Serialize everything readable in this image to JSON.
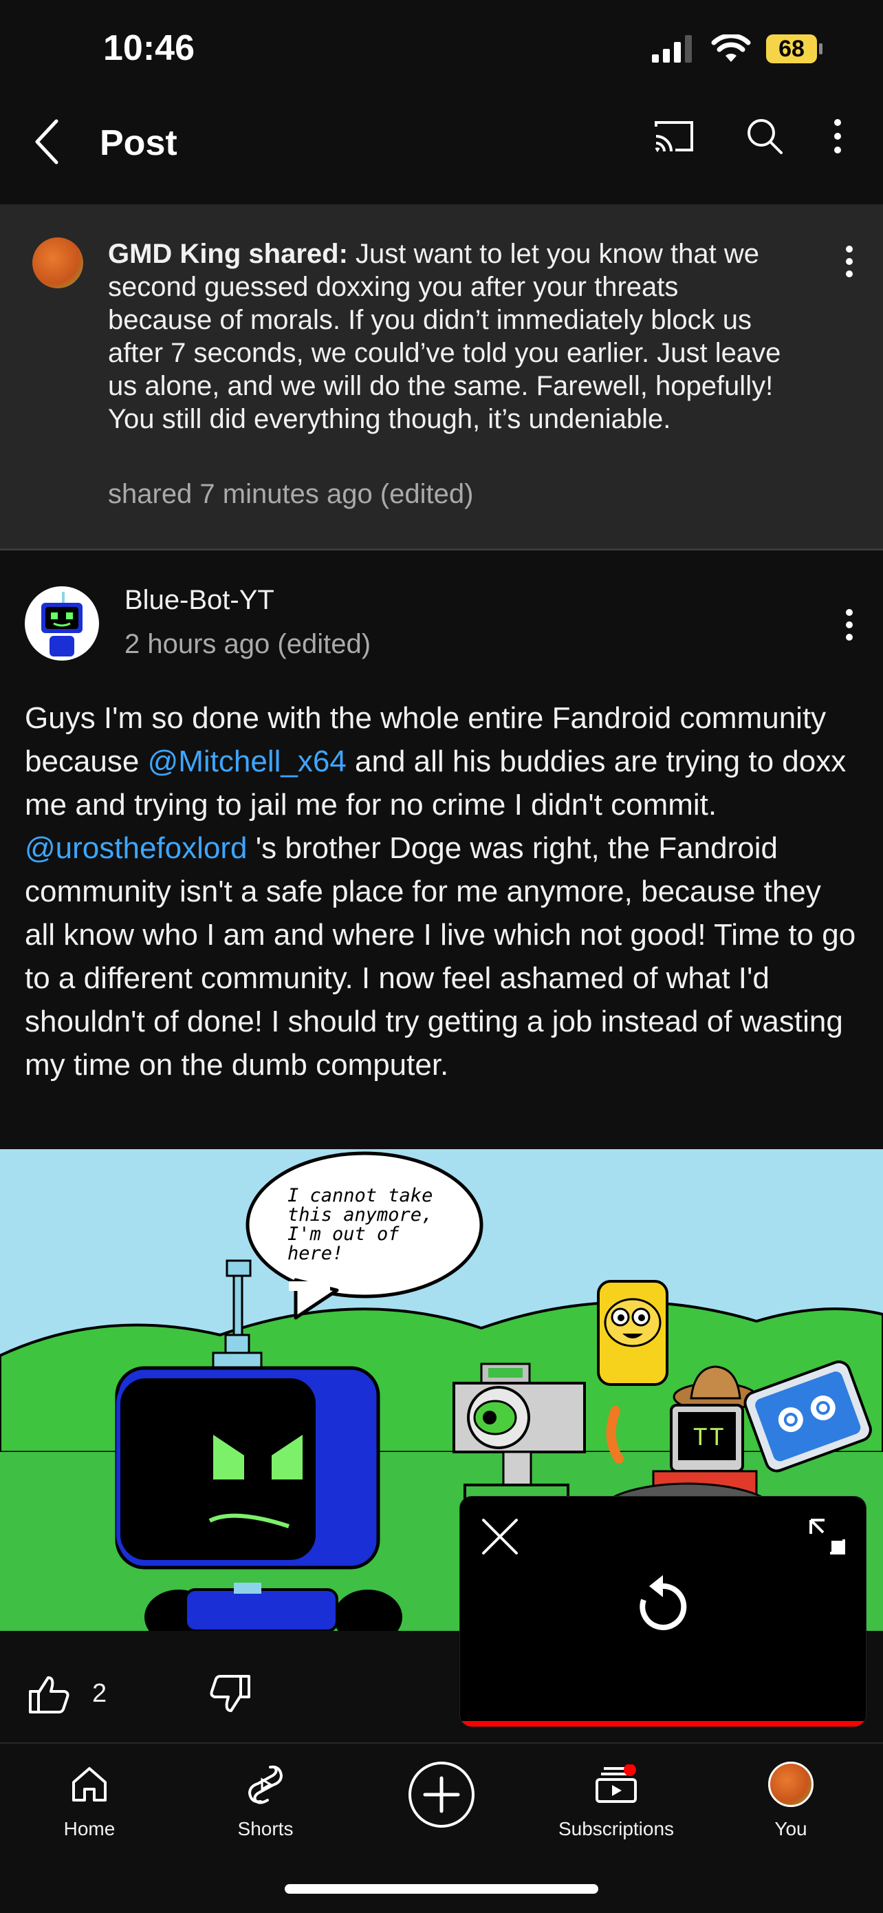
{
  "status_bar": {
    "time": "10:46",
    "battery": "68"
  },
  "header": {
    "title": "Post"
  },
  "shared_note": {
    "author_label": "GMD King shared:",
    "text": " Just want to let you know that we second guessed doxxing you after your threats because of morals. If you didn’t immediately block us after 7 seconds, we could’ve told you earlier. Just leave us alone, and we will do the same. Farewell, hopefully! You still did everything though, it’s undeniable.",
    "meta": "shared 7 minutes ago (edited)"
  },
  "post": {
    "author": "Blue-Bot-YT",
    "time": "2 hours ago (edited)",
    "body_1": "Guys I'm so done with the whole entire Fandroid community because ",
    "mention_1": "@Mitchell_x64",
    "body_2": "  and all his buddies are trying to doxx me and trying to jail me for no crime I didn't commit. ",
    "mention_2": "@urosthefoxlord",
    "body_3": " 's brother Doge was right, the Fandroid community isn't a safe place for me anymore, because they all know who I am and where I live which not good! Time to go to a different community. I now feel ashamed of what I'd shouldn't of done! I should try getting a job instead of wasting my time on the dumb computer.",
    "comic_speech": [
      "I cannot take",
      "this anymore,",
      "I'm out of",
      "here!"
    ],
    "like_count": "2"
  },
  "bottom_nav": {
    "home": "Home",
    "shorts": "Shorts",
    "subscriptions": "Subscriptions",
    "you": "You"
  },
  "colors": {
    "accent_link": "#3ea6ff",
    "progress": "#ff0000",
    "battery": "#f5d547"
  }
}
